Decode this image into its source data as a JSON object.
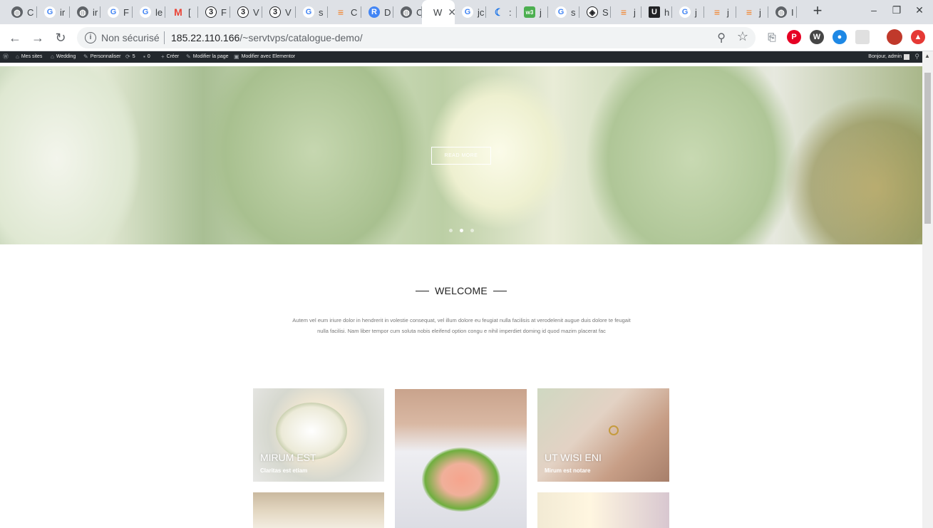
{
  "browser": {
    "tabs": [
      {
        "title": "C",
        "icon": "globe-icon",
        "color": "#5f6368"
      },
      {
        "title": "ir",
        "icon": "google-icon",
        "color": "#4285f4"
      },
      {
        "title": "ir",
        "icon": "globe-icon",
        "color": "#5f6368"
      },
      {
        "title": "F",
        "icon": "google-icon",
        "color": "#4285f4"
      },
      {
        "title": "le",
        "icon": "google-icon",
        "color": "#4285f4"
      },
      {
        "title": "[",
        "icon": "gmail-icon",
        "color": "#ea4335"
      },
      {
        "title": "F",
        "icon": "circle-3-icon",
        "color": "#202124"
      },
      {
        "title": "V",
        "icon": "circle-3-icon",
        "color": "#202124"
      },
      {
        "title": "V",
        "icon": "circle-3-icon",
        "color": "#202124"
      },
      {
        "title": "s",
        "icon": "google-icon",
        "color": "#4285f4"
      },
      {
        "title": "C",
        "icon": "stackoverflow-icon",
        "color": "#f48024"
      },
      {
        "title": "D",
        "icon": "r-icon",
        "color": "#4285f4"
      },
      {
        "title": "C",
        "icon": "globe-icon",
        "color": "#5f6368"
      },
      {
        "title": "W",
        "icon": "wedding-tab",
        "color": "#ffffff",
        "active": true
      },
      {
        "title": "jc",
        "icon": "google-icon",
        "color": "#4285f4"
      },
      {
        "title": ":",
        "icon": "moon-icon",
        "color": "#1a73e8"
      },
      {
        "title": "j",
        "icon": "w3-icon",
        "color": "#4caf50"
      },
      {
        "title": "s",
        "icon": "google-icon",
        "color": "#4285f4"
      },
      {
        "title": "S",
        "icon": "codepen-icon",
        "color": "#202124"
      },
      {
        "title": "j",
        "icon": "stackoverflow-icon",
        "color": "#f48024"
      },
      {
        "title": "h",
        "icon": "u-icon",
        "color": "#202124"
      },
      {
        "title": "j",
        "icon": "google-icon",
        "color": "#4285f4"
      },
      {
        "title": "j",
        "icon": "stackoverflow-icon",
        "color": "#f48024"
      },
      {
        "title": "j",
        "icon": "stackoverflow-icon",
        "color": "#f48024"
      },
      {
        "title": "I",
        "icon": "globe-icon",
        "color": "#5f6368"
      }
    ],
    "new_tab": "+",
    "win_min": "–",
    "win_max": "❐",
    "win_close": "✕",
    "omnibox": {
      "security": "Non sécurisé",
      "host": "185.22.110.166",
      "path": "/~servtvps/catalogue-demo/"
    }
  },
  "adminbar": {
    "items": [
      "Mes sites",
      "Wedding",
      "Personnaliser",
      "5",
      "0",
      "Créer",
      "Modifier la page",
      "Modifier avec Elementor"
    ],
    "user": "Bonjour, admin"
  },
  "hero": {
    "button": "READ MORE",
    "slides": 3,
    "active_slide": 2
  },
  "welcome": {
    "title": "WELCOME",
    "text": "Autem vel eum iriure dolor in hendrerit in volestie consequat, vel illum dolore eu feugiat nulla facilisis at verodelenit augue duis dolore te feugait nulla facilisi. Nam liber tempor cum soluta nobis eleifend option congu e nihil imperdiet doming id quod mazim placerat fac"
  },
  "gallery": [
    {
      "title": "MIRUM EST",
      "subtitle": "Claritas est etiam"
    },
    {
      "title": "",
      "subtitle": ""
    },
    {
      "title": "UT WISI ENI",
      "subtitle": "Mirum est notare"
    }
  ]
}
